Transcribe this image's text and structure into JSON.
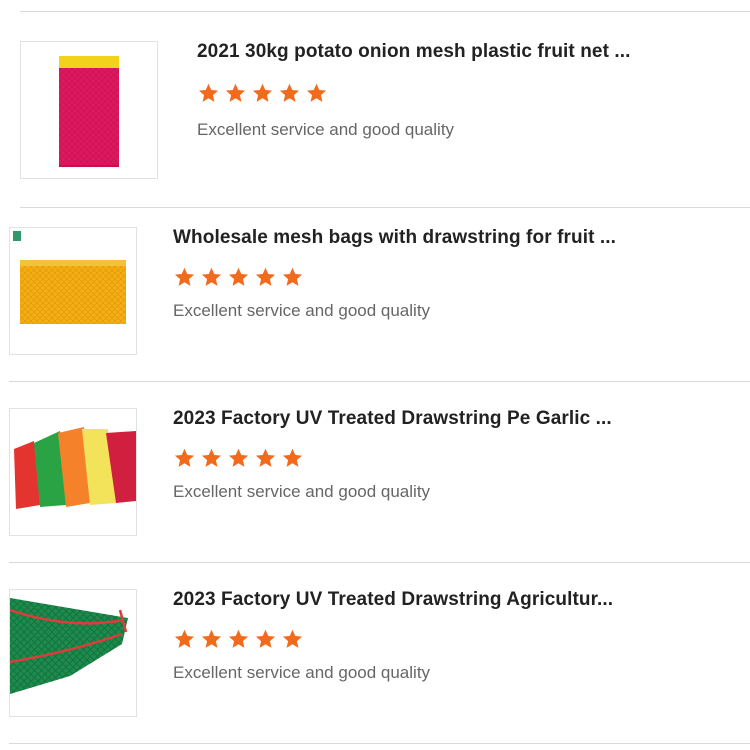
{
  "items": [
    {
      "title": "2021 30kg potato onion mesh plastic fruit net ...",
      "rating": 5,
      "review": "Excellent service and good quality",
      "image": "red-mesh-bag-image"
    },
    {
      "title": "Wholesale mesh bags with drawstring for fruit ...",
      "rating": 5,
      "review": "Excellent service and good quality",
      "image": "yellow-mesh-bag-image"
    },
    {
      "title": "2023 Factory UV Treated Drawstring Pe Garlic ...",
      "rating": 5,
      "review": "Excellent service and good quality",
      "image": "multicolor-mesh-bags-image"
    },
    {
      "title": "2023 Factory UV Treated Drawstring Agricultur...",
      "rating": 5,
      "review": "Excellent service and good quality",
      "image": "green-drawstring-mesh-bag-image"
    }
  ],
  "colors": {
    "star": "#f26a1b",
    "title": "#222222",
    "review": "#666666",
    "divider": "#d9d9d9"
  }
}
